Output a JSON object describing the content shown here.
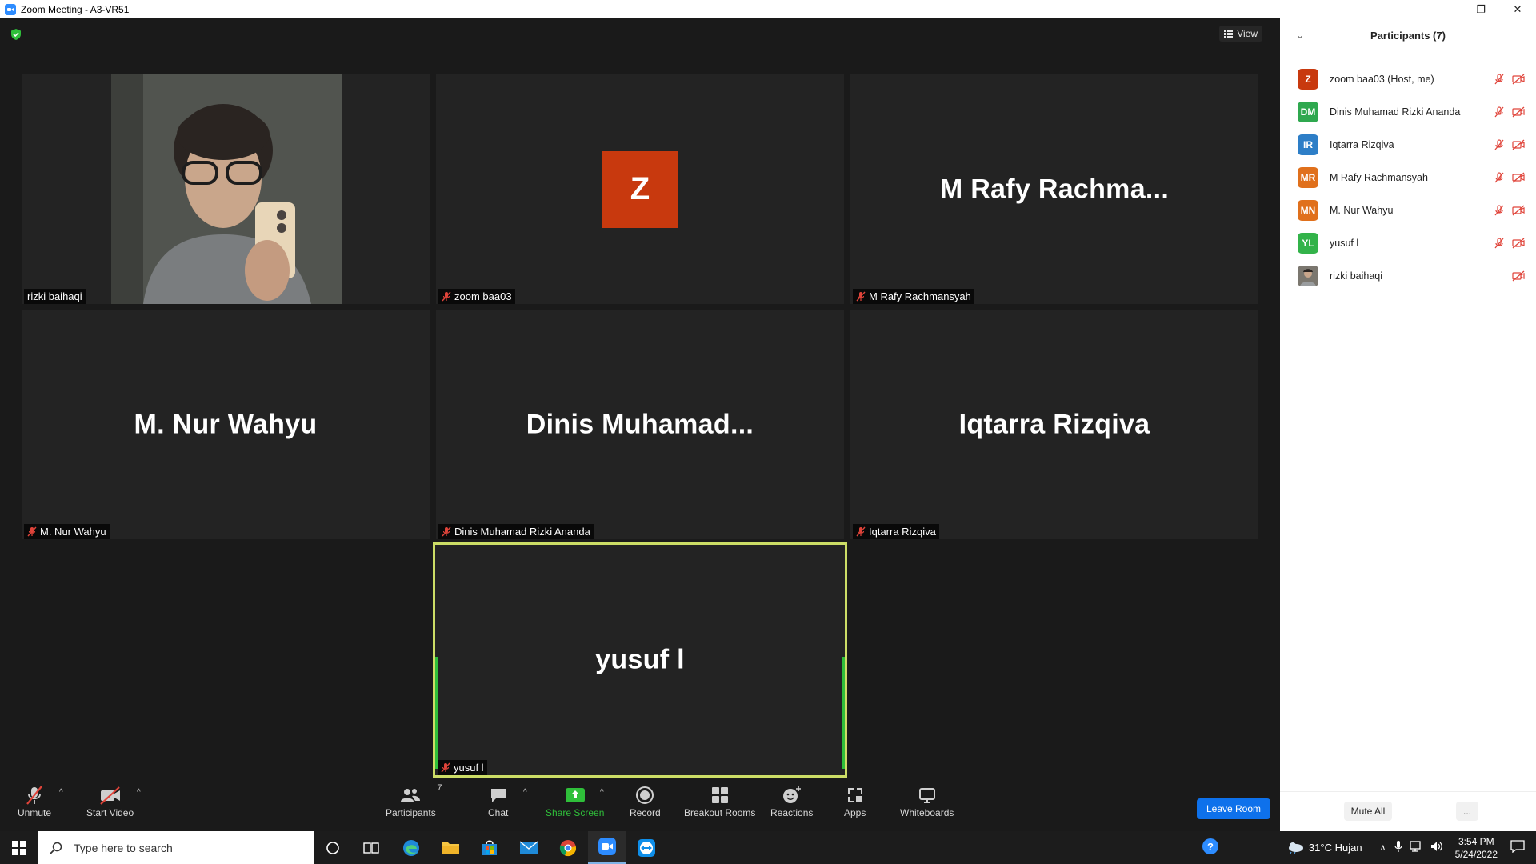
{
  "window": {
    "title": "Zoom Meeting - A3-VR51",
    "minimize": "—",
    "restore": "❐",
    "close": "✕"
  },
  "meeting": {
    "view_label": "View",
    "tiles": [
      {
        "display": "",
        "label": "rizki baihaqi",
        "muted": false,
        "type": "video"
      },
      {
        "display": "Z",
        "label": "zoom baa03",
        "muted": true,
        "type": "avatar"
      },
      {
        "display": "M  Rafy  Rachma...",
        "label": "M Rafy Rachmansyah",
        "muted": true,
        "type": "name"
      },
      {
        "display": "M. Nur Wahyu",
        "label": "M. Nur Wahyu",
        "muted": true,
        "type": "name"
      },
      {
        "display": "Dinis  Muhamad...",
        "label": "Dinis Muhamad Rizki Ananda",
        "muted": true,
        "type": "name"
      },
      {
        "display": "Iqtarra Rizqiva",
        "label": "Iqtarra Rizqiva",
        "muted": true,
        "type": "name"
      },
      {
        "display": "yusuf l",
        "label": "yusuf l",
        "muted": true,
        "type": "name",
        "active_speaker": true
      }
    ]
  },
  "toolbar": {
    "unmute": "Unmute",
    "start_video": "Start Video",
    "participants": "Participants",
    "participants_count": "7",
    "chat": "Chat",
    "share_screen": "Share Screen",
    "record": "Record",
    "breakout_rooms": "Breakout Rooms",
    "reactions": "Reactions",
    "apps": "Apps",
    "whiteboards": "Whiteboards",
    "leave": "Leave Room"
  },
  "panel": {
    "title": "Participants (7)",
    "participants": [
      {
        "initials": "Z",
        "name": "zoom baa03 (Host, me)",
        "color": "#c8390e",
        "mic_muted": true,
        "video_off": true
      },
      {
        "initials": "DM",
        "name": "Dinis Muhamad Rizki Ananda",
        "color": "#2fa84f",
        "mic_muted": true,
        "video_off": true
      },
      {
        "initials": "IR",
        "name": "Iqtarra Rizqiva",
        "color": "#2d7ec7",
        "mic_muted": true,
        "video_off": true
      },
      {
        "initials": "MR",
        "name": "M Rafy Rachmansyah",
        "color": "#e0701c",
        "mic_muted": true,
        "video_off": true
      },
      {
        "initials": "MN",
        "name": "M. Nur Wahyu",
        "color": "#e0701c",
        "mic_muted": true,
        "video_off": true
      },
      {
        "initials": "YL",
        "name": "yusuf l",
        "color": "#33b34a",
        "mic_muted": true,
        "video_off": true
      },
      {
        "initials": "",
        "name": "rizki baihaqi",
        "color": "#6b6258",
        "mic_muted": false,
        "video_off": true,
        "photo": true
      }
    ],
    "mute_all": "Mute All",
    "more": "..."
  },
  "taskbar": {
    "search_placeholder": "Type here to search",
    "weather": "31°C  Hujan",
    "time": "3:54 PM",
    "date": "5/24/2022"
  }
}
